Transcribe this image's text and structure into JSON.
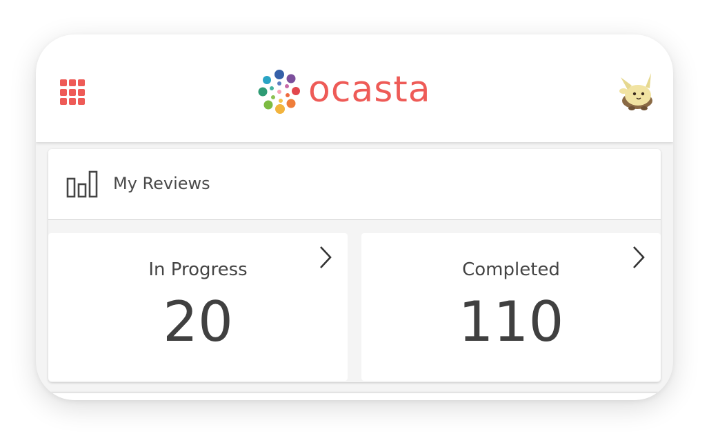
{
  "header": {
    "logo_text": "ocasta",
    "apps_icon": "grid-apps-icon",
    "avatar_icon": "creature-avatar-icon",
    "accent_color": "#ee5b57"
  },
  "reviews": {
    "icon": "bar-chart-icon",
    "title": "My Reviews",
    "stats": [
      {
        "label": "In Progress",
        "value": "20",
        "icon": "chevron-right-icon"
      },
      {
        "label": "Completed",
        "value": "110",
        "icon": "chevron-right-icon"
      }
    ]
  }
}
